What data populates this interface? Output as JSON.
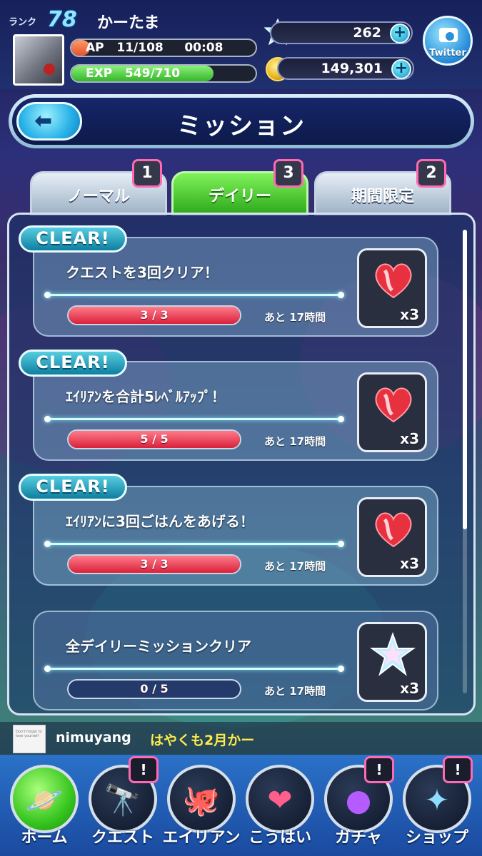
{
  "header": {
    "rank_label": "ランク",
    "rank": "78",
    "player_name": "かーたま",
    "ap_label": "AP",
    "ap_value": "11/108",
    "ap_timer": "00:08",
    "ap_fraction": 0.1,
    "exp_label": "EXP",
    "exp_value": "549/710",
    "exp_fraction": 0.77,
    "stars": "262",
    "coins": "149,301",
    "twitter_label": "Twitter"
  },
  "title_bar": {
    "title": "ミッション",
    "back_icon": "left-arrow-icon"
  },
  "tabs": [
    {
      "label": "ノーマル",
      "badge": "1",
      "active": false
    },
    {
      "label": "デイリー",
      "badge": "3",
      "active": true
    },
    {
      "label": "期間限定",
      "badge": "2",
      "active": false
    }
  ],
  "missions": [
    {
      "clear_label": "CLEAR!",
      "title": "クエストを3回クリア！",
      "progress_text": "3 / 3",
      "progress": 1.0,
      "remaining": "あと 17時間",
      "reward_qty": "x3",
      "reward_icon": "heart-gift-icon"
    },
    {
      "clear_label": "CLEAR!",
      "title": "ｴｲﾘｱﾝを合計5ﾚﾍﾞﾙｱｯﾌﾟ！",
      "progress_text": "5 / 5",
      "progress": 1.0,
      "remaining": "あと 17時間",
      "reward_qty": "x3",
      "reward_icon": "heart-gift-icon"
    },
    {
      "clear_label": "CLEAR!",
      "title": "ｴｲﾘｱﾝに3回ごはんをあげる！",
      "progress_text": "3 / 3",
      "progress": 1.0,
      "remaining": "あと 17時間",
      "reward_qty": "x3",
      "reward_icon": "heart-gift-icon"
    },
    {
      "clear_label": "",
      "title": "全デイリーミッションクリア",
      "progress_text": "0 / 5",
      "progress": 0.0,
      "remaining": "あと 17時間",
      "reward_qty": "x3",
      "reward_icon": "crystal-star-icon"
    }
  ],
  "chat": {
    "name": "nimuyang",
    "message": "はやくも2月かー",
    "avatar_text": "Don't forget to love yourself"
  },
  "nav": [
    {
      "label": "ホーム",
      "badge": "",
      "icon": "planet-icon"
    },
    {
      "label": "クエスト",
      "badge": "!",
      "icon": "telescope-icon"
    },
    {
      "label": "エイリアン",
      "badge": "",
      "icon": "octopus-icon"
    },
    {
      "label": "こうはい",
      "badge": "",
      "icon": "hearts-icon"
    },
    {
      "label": "ガチャ",
      "badge": "!",
      "icon": "alien-blob-icon"
    },
    {
      "label": "ショップ",
      "badge": "!",
      "icon": "crystal-icon"
    }
  ],
  "colors": {
    "accent_pink": "#ff69b4",
    "active_tab": "#3fbf24",
    "progress_red": "#d9213a"
  }
}
